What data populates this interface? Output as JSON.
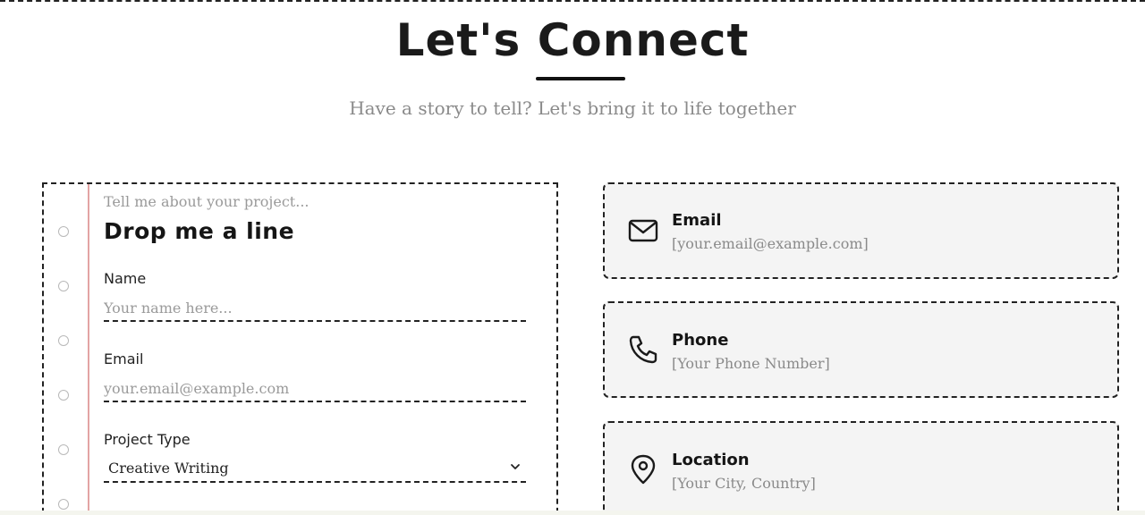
{
  "header": {
    "title": "Let's Connect",
    "subtitle": "Have a story to tell? Let's bring it to life together"
  },
  "form": {
    "hint": "Tell me about your project...",
    "heading": "Drop me a line",
    "name_label": "Name",
    "name_placeholder": "Your name here...",
    "email_label": "Email",
    "email_placeholder": "your.email@example.com",
    "project_type_label": "Project Type",
    "project_type_value": "Creative Writing"
  },
  "contact": [
    {
      "title": "Email",
      "value": "[your.email@example.com]",
      "icon": "envelope-icon"
    },
    {
      "title": "Phone",
      "value": "[Your Phone Number]",
      "icon": "phone-icon"
    },
    {
      "title": "Location",
      "value": "[Your City, Country]",
      "icon": "location-pin-icon"
    }
  ],
  "colors": {
    "text": "#1a1a1a",
    "muted": "#8a8a8a",
    "card_bg": "#f4f4f4",
    "margin_line": "#e3a4a4"
  }
}
